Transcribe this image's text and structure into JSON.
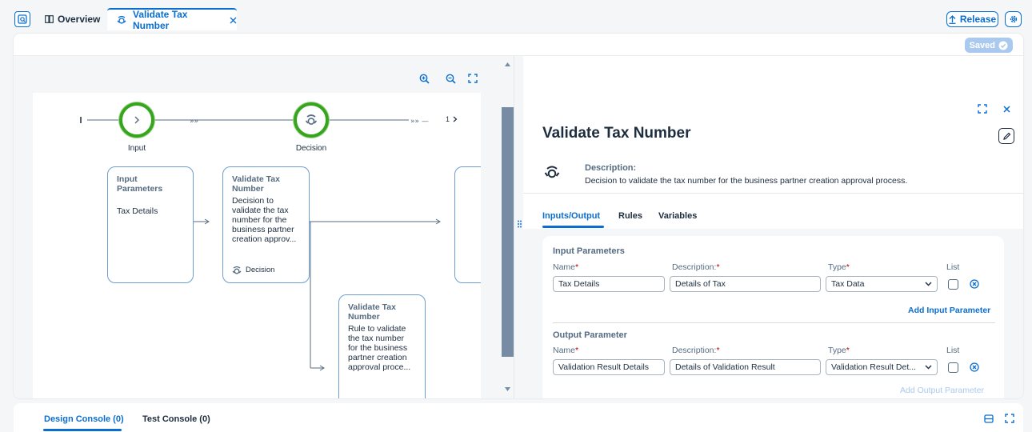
{
  "tabs": {
    "overview_label": "Overview",
    "active_label": "Validate Tax Number"
  },
  "toolbar": {
    "release_label": "Release",
    "saved_label": "Saved"
  },
  "canvas": {
    "nodes": {
      "input_label": "Input",
      "decision_label": "Decision",
      "flow_count": "1"
    },
    "cards": {
      "input_params_title": "Input Parameters",
      "input_params_item": "Tax Details",
      "decision_title": "Validate Tax Number",
      "decision_desc": "Decision to validate the tax number for the business partner creation approv...",
      "decision_type": "Decision",
      "rule_title": "Validate Tax Number",
      "rule_desc": "Rule to validate the tax number for the business partner creation approval proce..."
    }
  },
  "detail": {
    "title": "Validate Tax Number",
    "description_label": "Description:",
    "description_text": "Decision to validate the tax number for the business partner creation approval process.",
    "tabs": [
      "Inputs/Output",
      "Rules",
      "Variables"
    ],
    "input_section": {
      "title": "Input Parameters",
      "col_name": "Name",
      "col_description": "Description:",
      "col_type": "Type",
      "col_list": "List",
      "row": {
        "name": "Tax Details",
        "description": "Details of Tax",
        "type": "Tax Data"
      },
      "add_label": "Add Input Parameter"
    },
    "output_section": {
      "title": "Output Parameter",
      "col_name": "Name",
      "col_description": "Description:",
      "col_type": "Type",
      "col_list": "List",
      "row": {
        "name": "Validation Result Details",
        "description": "Details of Validation Result",
        "type": "Validation Result Det..."
      },
      "add_label": "Add Output Parameter"
    }
  },
  "console": {
    "tabs": [
      "Design Console (0)",
      "Test Console (0)"
    ]
  },
  "colors": {
    "accent": "#0a6ed1",
    "node_green": "#36a41d",
    "required": "#bb0000"
  }
}
